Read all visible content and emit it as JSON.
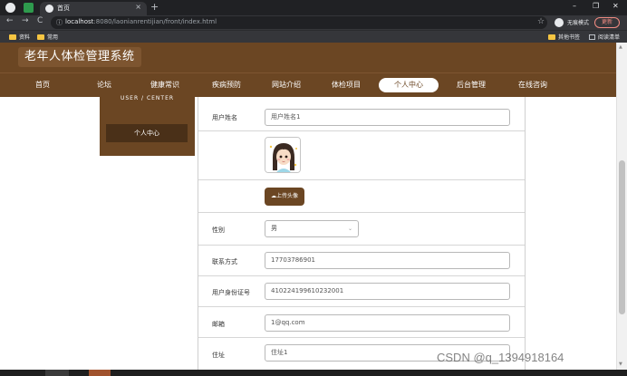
{
  "browser": {
    "tab_title": "首页",
    "tab_close": "×",
    "new_tab": "+",
    "url_host": "localhost",
    "url_path": ":8080/laonianrentijian/front/index.html",
    "incognito_label": "无痕模式",
    "update_label": "更新",
    "bookmarks": [
      "资料",
      "常用"
    ],
    "other_bookmarks": "其他书签",
    "reading_list": "阅读清单",
    "window_controls": [
      "–",
      "❐",
      "✕"
    ]
  },
  "site": {
    "title": "老年人体检管理系统",
    "nav": [
      "首页",
      "论坛",
      "健康常识",
      "疾病预防",
      "网站介绍",
      "体检项目",
      "个人中心",
      "后台管理",
      "在线咨询"
    ],
    "active_nav_index": 6
  },
  "user_panel": {
    "heading": "USER / CENTER",
    "menu_item": "个人中心"
  },
  "form": {
    "username_label": "用户姓名",
    "username_value": "用户姓名1",
    "upload_button": "上传头像",
    "gender_label": "性别",
    "gender_value": "男",
    "phone_label": "联系方式",
    "phone_value": "17703786901",
    "idcard_label": "用户身份证号",
    "idcard_value": "410224199610232001",
    "email_label": "邮箱",
    "email_value": "1@qq.com",
    "address_label": "住址",
    "address_value": "住址1"
  },
  "watermark": "CSDN @q_1394918164",
  "colors": {
    "brand_brown": "#6b4623",
    "dark_brown": "#4a3018"
  },
  "icons": {
    "upload": "cloud-upload-icon",
    "dropdown": "chevron-down-icon"
  }
}
